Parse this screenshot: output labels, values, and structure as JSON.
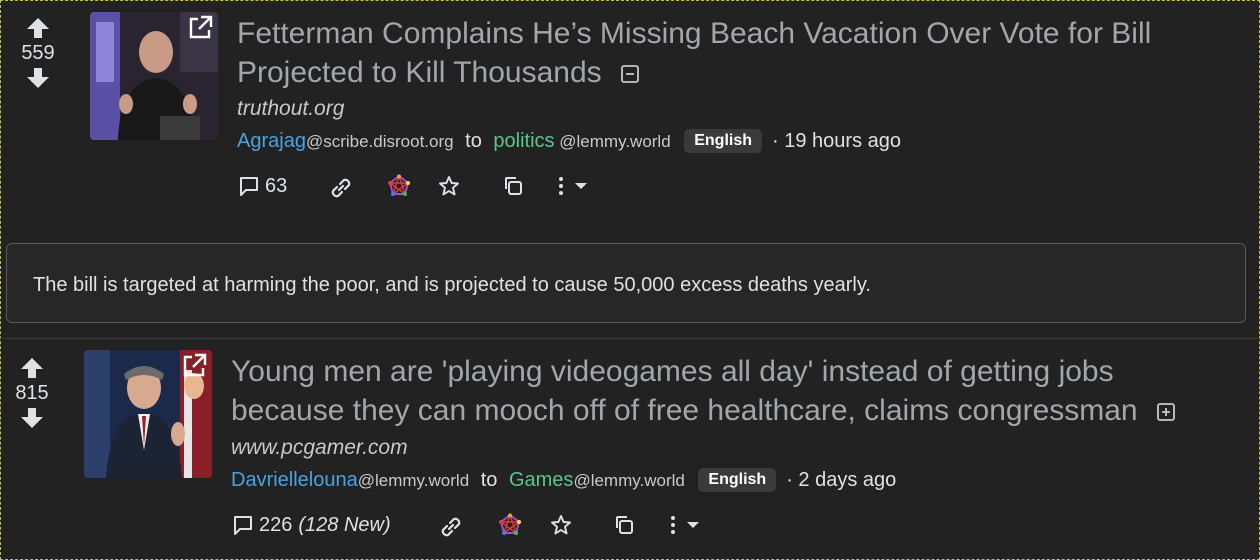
{
  "posts": [
    {
      "score": "559",
      "title": "Fetterman Complains He’s Missing Beach Vacation Over Vote for Bill Projected to Kill Thousands",
      "title_line1": "Fetterman Complains He’s Missing Beach Vacation Over Vote for Bill",
      "title_line2": "Projected to Kill Thousands",
      "domain": "truthout.org",
      "user": "Agrajag",
      "user_instance": "@scribe.disroot.org",
      "to": "to",
      "community": "politics",
      "community_instance": " @lemmy.world",
      "language": "English",
      "time": "· 19 hours ago",
      "comments": "63",
      "expanded": true,
      "body": "The bill is targeted at harming the poor, and is projected to cause 50,000 excess deaths yearly."
    },
    {
      "score": "815",
      "title_line1": "Young men are 'playing videogames all day' instead of getting jobs",
      "title_line2": "because they can mooch off of free healthcare, claims congressman",
      "domain": "www.pcgamer.com",
      "user": "Davriellelouna",
      "user_instance": "@lemmy.world",
      "to": "to",
      "community": "Games",
      "community_instance": "@lemmy.world",
      "language": "English",
      "time": "· 2 days ago",
      "comments": "226",
      "comments_new": "(128 New)",
      "expanded": false
    }
  ],
  "icons": [
    "upvote-icon",
    "downvote-icon",
    "external-link-icon",
    "collapse-icon",
    "expand-icon",
    "comment-icon",
    "link-icon",
    "fediverse-icon",
    "star-icon",
    "copy-icon",
    "more-icon",
    "caret-down-icon"
  ],
  "colors": {
    "background": "#222222",
    "user": "#4aa3df",
    "community": "#5cc58d",
    "title": "#a3a6aa"
  }
}
